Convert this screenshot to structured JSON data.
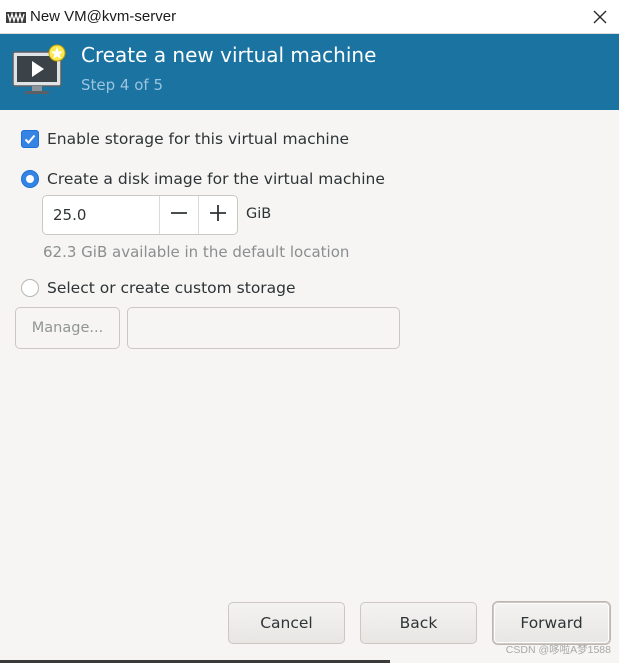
{
  "window": {
    "title": "New VM@kvm-server"
  },
  "header": {
    "title": "Create a new virtual machine",
    "step": "Step 4 of 5"
  },
  "storage": {
    "enable_label": "Enable storage for this virtual machine",
    "enable_checked": true,
    "disk_image_label": "Create a disk image for the virtual machine",
    "disk_image_selected": true,
    "size_value": "25.0",
    "size_unit": "GiB",
    "available_text": "62.3 GiB available in the default location",
    "custom_label": "Select or create custom storage",
    "custom_selected": false,
    "manage_label": "Manage...",
    "custom_path_value": ""
  },
  "footer": {
    "cancel_label": "Cancel",
    "back_label": "Back",
    "forward_label": "Forward"
  },
  "watermark": "CSDN @哆啦A梦1588",
  "icons": {
    "app": "virt-manager-icon",
    "header": "vm-monitor-icon",
    "close": "close-icon",
    "minus": "minus-icon",
    "plus": "plus-icon",
    "check": "checkmark-icon"
  },
  "colors": {
    "accent": "#1a73a1",
    "selection": "#3584e4",
    "step_text": "#9cc4df"
  }
}
